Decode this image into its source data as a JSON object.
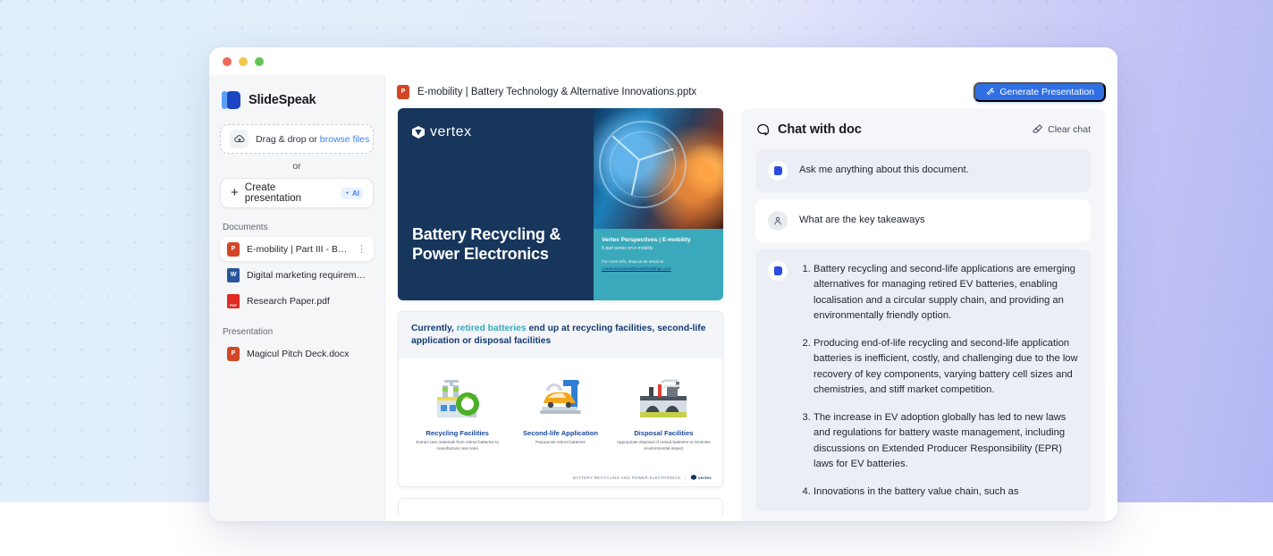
{
  "window": {
    "traffic_lights": [
      "close",
      "minimize",
      "maximize"
    ]
  },
  "sidebar": {
    "brand": "SlideSpeak",
    "dropzone": {
      "text": "Drag & drop or ",
      "link": "browse files",
      "icon": "upload-cloud-icon"
    },
    "or_label": "or",
    "create_button": {
      "label": "Create presentation",
      "badge": "AI",
      "icon": "plus-icon"
    },
    "sections": [
      {
        "label": "Documents",
        "items": [
          {
            "name": "E-mobility | Part III - Bat...",
            "type": "ppt",
            "active": true,
            "menu": "kebab-menu-icon"
          },
          {
            "name": "Digital marketing requiremen...",
            "type": "doc",
            "active": false
          },
          {
            "name": "Research Paper.pdf",
            "type": "pdf",
            "active": false
          }
        ]
      },
      {
        "label": "Presentation",
        "items": [
          {
            "name": "Magicul Pitch Deck.docx",
            "type": "ppt",
            "active": false
          }
        ]
      }
    ]
  },
  "topbar": {
    "doc_icon": "powerpoint-file-icon",
    "doc_title": "E-mobility | Battery Technology & Alternative Innovations.pptx",
    "generate_button": {
      "label": "Generate Presentation",
      "icon": "magic-wand-icon",
      "color": "#2f6fe4"
    }
  },
  "deck": {
    "slide1": {
      "logo": "vertex",
      "title": "Battery Recycling & Power Electronics",
      "teal_heading": "Vertex Perspectives | E-mobility",
      "teal_sub": "5-part series on e-mobility",
      "teal_note": "For more info, drop us an email at",
      "teal_email": "communications@vertexholdings.com"
    },
    "slide2": {
      "heading_pre": "Currently, ",
      "heading_highlight": "retired batteries",
      "heading_post": " end up at recycling facilities, second-life application or disposal facilities",
      "columns": [
        {
          "art": "recycling-plant-icon",
          "title": "Recycling Facilities",
          "caption": "Extract rare materials from retired batteries to manufacture new ones"
        },
        {
          "art": "robot-arm-car-icon",
          "title": "Second-life Application",
          "caption": "Repurpose retired batteries"
        },
        {
          "art": "disposal-plant-icon",
          "title": "Disposal Facilities",
          "caption": "Appropriate disposal of retired batteries to minimise environmental impact"
        }
      ],
      "footer": "BATTERY RECYCLING AND POWER ELECTRONICS",
      "footer_brand": "vertex"
    }
  },
  "chat": {
    "title": "Chat with doc",
    "title_icon": "chat-bubble-icon",
    "clear": {
      "label": "Clear chat",
      "icon": "eraser-icon"
    },
    "messages": [
      {
        "role": "bot",
        "text": "Ask me anything about this document."
      },
      {
        "role": "user",
        "text": "What are the key takeaways"
      }
    ],
    "answer": {
      "role": "bot",
      "items": [
        "Battery recycling and second-life applications are emerging alternatives for managing retired EV batteries, enabling localisation and a circular supply chain, and providing an environmentally friendly option.",
        "Producing end-of-life recycling and second-life application batteries is inefficient, costly, and challenging due to the low recovery of key components, varying battery cell sizes and chemistries, and stiff market competition.",
        "The increase in EV adoption globally has led to new laws and regulations for battery waste management, including discussions on Extended Producer Responsibility (EPR) laws for EV batteries.",
        "Innovations in the battery value chain, such as"
      ]
    }
  },
  "colors": {
    "accent": "#2f6fe4",
    "link": "#3b7ff0",
    "slide_navy": "#17365c",
    "slide_teal": "#3aa9bb",
    "sidebar_bg": "#f5f6f8",
    "chat_bg": "#f5f6f9"
  }
}
